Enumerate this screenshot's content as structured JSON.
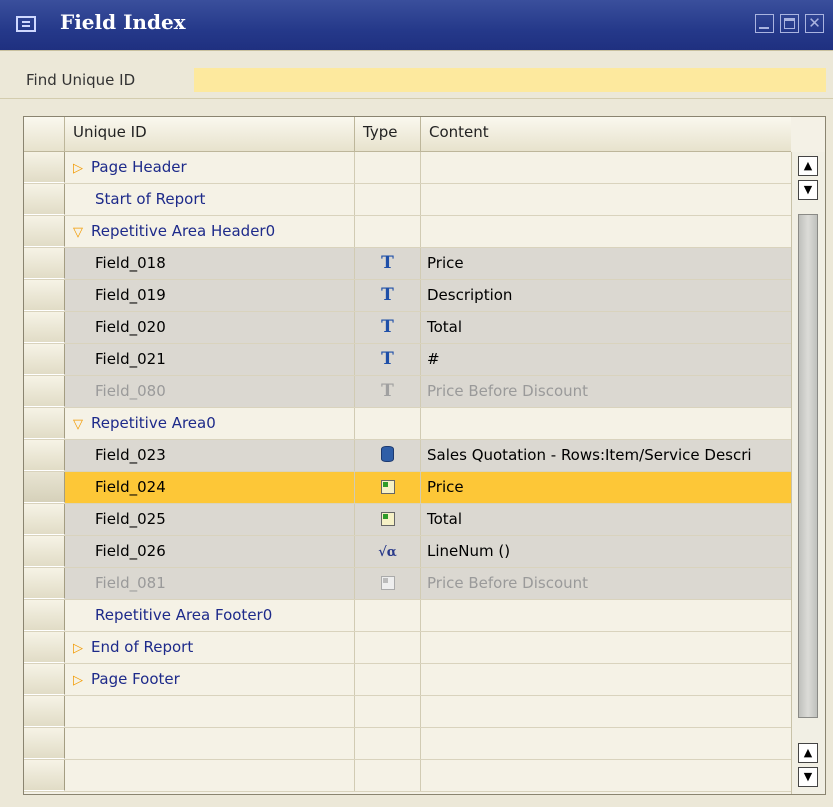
{
  "window": {
    "title": "Field Index",
    "title_icon": "field-index-icon",
    "controls": [
      "minimize-icon",
      "maximize-icon",
      "close-icon"
    ]
  },
  "find": {
    "label": "Find Unique ID",
    "value": ""
  },
  "table": {
    "columns": {
      "unique_id": "Unique ID",
      "type": "Type",
      "content": "Content"
    },
    "rows": [
      {
        "kind": "section",
        "expander": "collapsed",
        "id": "Page Header",
        "type_icon": "",
        "content": ""
      },
      {
        "kind": "section",
        "expander": "none",
        "id": "Start of Report",
        "type_icon": "",
        "content": ""
      },
      {
        "kind": "section",
        "expander": "expanded",
        "id": "Repetitive Area Header0",
        "type_icon": "",
        "content": ""
      },
      {
        "kind": "field",
        "id": "Field_018",
        "type_icon": "text-field-icon",
        "content": "Price"
      },
      {
        "kind": "field",
        "id": "Field_019",
        "type_icon": "text-field-icon",
        "content": "Description"
      },
      {
        "kind": "field",
        "id": "Field_020",
        "type_icon": "text-field-icon",
        "content": "Total"
      },
      {
        "kind": "field",
        "id": "Field_021",
        "type_icon": "text-field-icon",
        "content": "#"
      },
      {
        "kind": "field-disabled",
        "id": "Field_080",
        "type_icon": "text-field-icon",
        "content": "Price Before Discount"
      },
      {
        "kind": "section",
        "expander": "expanded",
        "id": "Repetitive Area0",
        "type_icon": "",
        "content": ""
      },
      {
        "kind": "field",
        "id": "Field_023",
        "type_icon": "database-field-icon",
        "content": "Sales Quotation - Rows:Item/Service Descri"
      },
      {
        "kind": "selected",
        "id": "Field_024",
        "type_icon": "linked-field-icon",
        "content": "Price"
      },
      {
        "kind": "field",
        "id": "Field_025",
        "type_icon": "linked-field-icon",
        "content": "Total"
      },
      {
        "kind": "field",
        "id": "Field_026",
        "type_icon": "formula-field-icon",
        "content": "LineNum ()"
      },
      {
        "kind": "field-disabled",
        "id": "Field_081",
        "type_icon": "linked-field-icon",
        "content": "Price Before Discount"
      },
      {
        "kind": "section",
        "expander": "none",
        "id": "Repetitive Area Footer0",
        "type_icon": "",
        "content": ""
      },
      {
        "kind": "section",
        "expander": "collapsed",
        "id": "End of Report",
        "type_icon": "",
        "content": ""
      },
      {
        "kind": "section",
        "expander": "collapsed",
        "id": "Page Footer",
        "type_icon": "",
        "content": ""
      },
      {
        "kind": "empty",
        "id": "",
        "type_icon": "",
        "content": ""
      },
      {
        "kind": "empty",
        "id": "",
        "type_icon": "",
        "content": ""
      },
      {
        "kind": "empty",
        "id": "",
        "type_icon": "",
        "content": ""
      }
    ]
  },
  "colors": {
    "titlebar": "#25398a",
    "find_input": "#fde99e",
    "selected_row": "#fdc737",
    "field_row": "#dbd8d1",
    "section_text": "#1d2a8a",
    "expander": "#f29a00"
  }
}
